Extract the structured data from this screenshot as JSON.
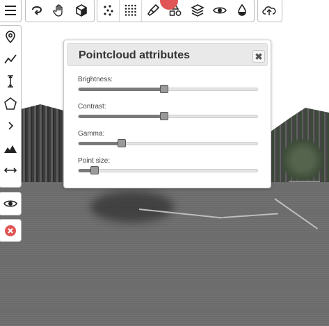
{
  "dialog": {
    "title": "Pointcloud attributes",
    "close_glyph": "✖",
    "sliders": [
      {
        "label": "Brightness:",
        "value": 0.48
      },
      {
        "label": "Contrast:",
        "value": 0.48
      },
      {
        "label": "Gamma:",
        "value": 0.24
      },
      {
        "label": "Point size:",
        "value": 0.09
      }
    ]
  },
  "top_toolbar": {
    "groups": [
      [
        "menu-icon"
      ],
      [
        "rotate-icon",
        "hand-pan-icon",
        "cube-icon"
      ],
      [
        "sparse-points-icon",
        "dense-points-icon",
        "brush-icon",
        "shapes-icon",
        "layers-icon",
        "eye-icon",
        "drop-icon"
      ],
      [
        "cloud-upload-icon"
      ]
    ]
  },
  "left_toolbar": {
    "groups": [
      [
        "map-pin-icon",
        "polyline-icon",
        "height-icon",
        "polygon-icon",
        "chevron-right-icon",
        "terrain-icon",
        "distance-icon"
      ],
      [
        "eye-icon"
      ],
      [
        "close-red-icon"
      ]
    ]
  },
  "colors": {
    "accent_red": "#e05555",
    "slider_handle": "#9a9a9a",
    "dialog_header": "#e9e9e9"
  }
}
